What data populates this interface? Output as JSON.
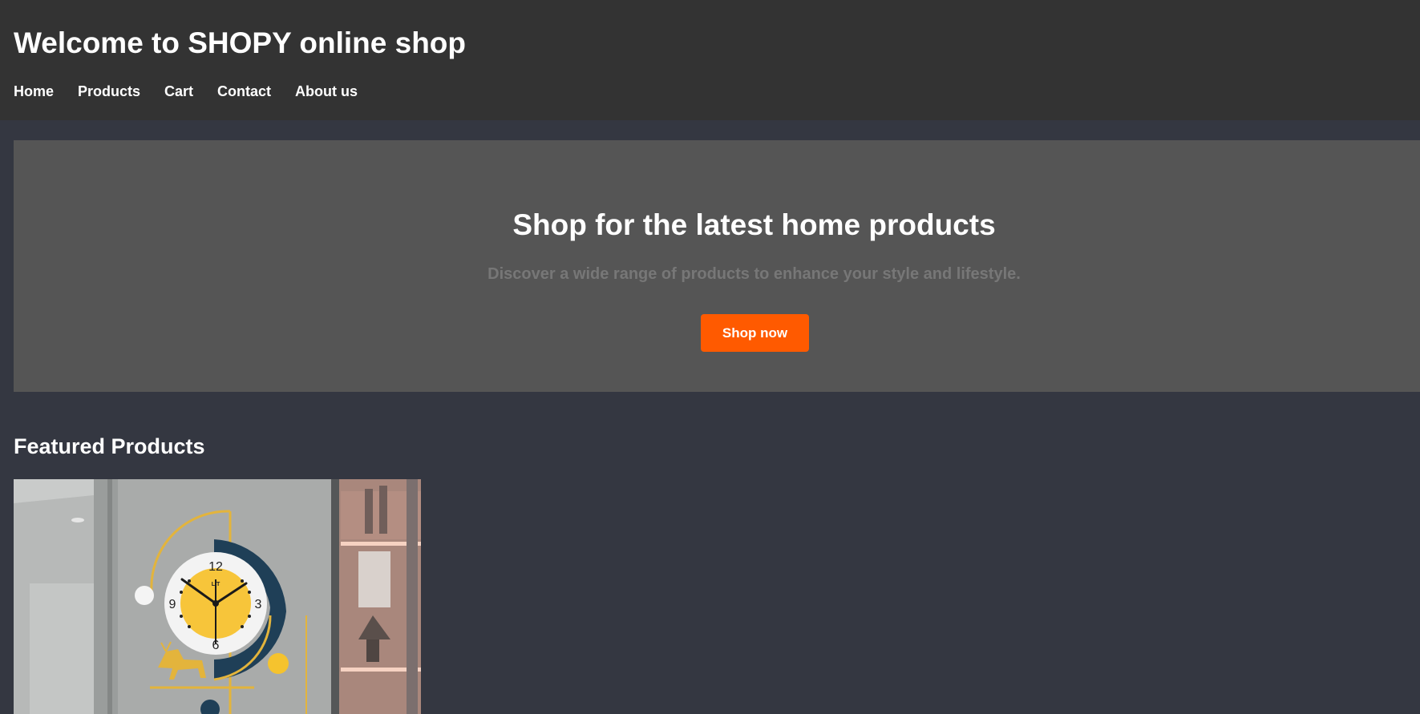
{
  "header": {
    "title": "Welcome to SHOPY online shop",
    "nav": [
      "Home",
      "Products",
      "Cart",
      "Contact",
      "About us"
    ]
  },
  "hero": {
    "title": "Shop for the latest home products",
    "subtitle": "Discover a wide range of products to enhance your style and lifestyle.",
    "cta_label": "Shop now"
  },
  "featured": {
    "title": "Featured Products",
    "products": [
      {
        "image": "wall-clock-product-image",
        "clock_numbers": [
          "12",
          "3",
          "6",
          "9"
        ],
        "brand_mark": "LIT"
      }
    ]
  },
  "colors": {
    "page_bg": "#343741",
    "header_bg": "#333333",
    "hero_bg": "#555555",
    "accent": "#ff5a00",
    "subtitle": "#777777"
  }
}
